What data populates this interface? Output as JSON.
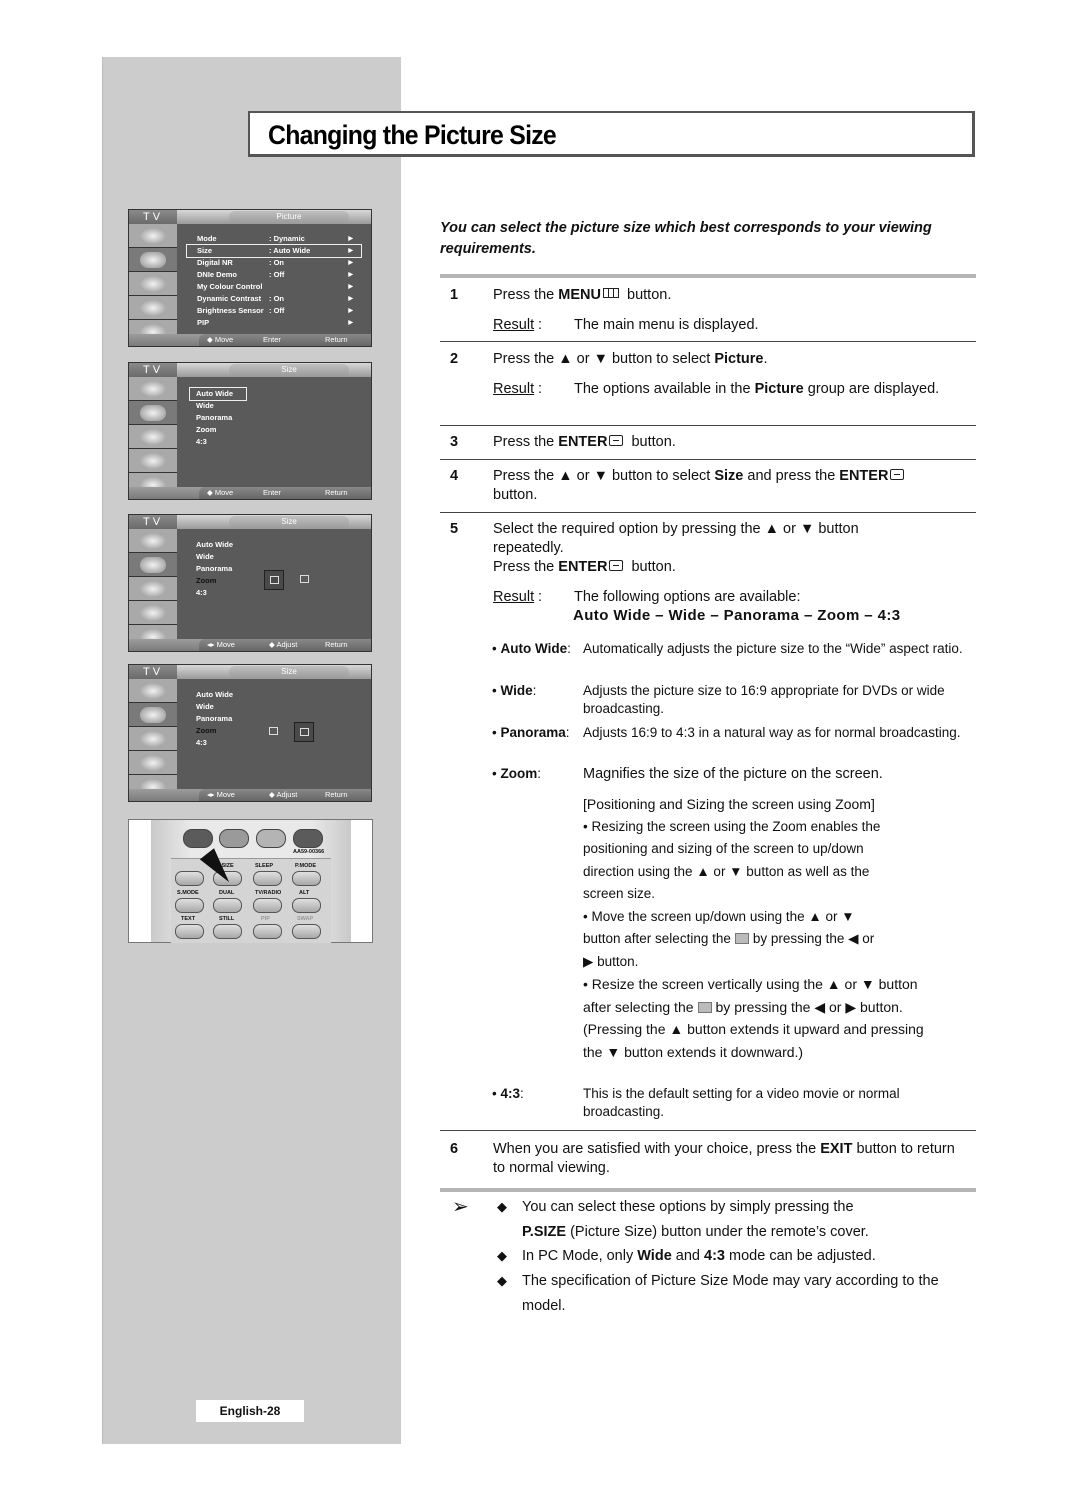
{
  "page": {
    "title": "Changing the Picture Size",
    "intro": "You can select the picture size which best corresponds to your viewing requirements.",
    "page_number": "English-28"
  },
  "osd_screens": [
    {
      "tv_label": "TV",
      "menu_title": "Picture",
      "rows": [
        {
          "label": "Mode",
          "value": ": Dynamic"
        },
        {
          "label": "Size",
          "value": ": Auto Wide",
          "highlighted": true
        },
        {
          "label": "Digital NR",
          "value": ": On"
        },
        {
          "label": "DNIe Demo",
          "value": ": Off"
        },
        {
          "label": "My Colour Control",
          "value": ""
        },
        {
          "label": "Dynamic Contrast",
          "value": ": On"
        },
        {
          "label": "Brightness Sensor",
          "value": ": Off"
        },
        {
          "label": "PIP",
          "value": ""
        }
      ],
      "hints": [
        "◆ Move",
        "Enter",
        "Return"
      ]
    },
    {
      "tv_label": "TV",
      "menu_title": "Size",
      "rows": [
        "Auto Wide",
        "Wide",
        "Panorama",
        "Zoom",
        "4:3"
      ],
      "selected": "Auto Wide",
      "hints": [
        "◆ Move",
        "Enter",
        "Return"
      ]
    },
    {
      "tv_label": "TV",
      "menu_title": "Size",
      "rows": [
        "Auto Wide",
        "Wide",
        "Panorama",
        "Zoom",
        "4:3"
      ],
      "selected": "Zoom",
      "zoom_focus": "position",
      "hints": [
        "◂▸ Move",
        "◆ Adjust",
        "Return"
      ]
    },
    {
      "tv_label": "TV",
      "menu_title": "Size",
      "rows": [
        "Auto Wide",
        "Wide",
        "Panorama",
        "Zoom",
        "4:3"
      ],
      "selected": "Zoom",
      "zoom_focus": "size",
      "hints": [
        "◂▸ Move",
        "◆ Adjust",
        "Return"
      ]
    }
  ],
  "remote": {
    "model_code": "AA59-00366",
    "color_buttons": [
      "#5b5b5b",
      "#9a9a9a",
      "#b4b4b4",
      "#5b5b5b"
    ],
    "row1": [
      "",
      "P.SIZE",
      "SLEEP",
      "P.MODE"
    ],
    "row2": [
      "S.MODE",
      "DUAL",
      "TV/RADIO",
      "ALT"
    ],
    "row3": [
      "TEXT",
      "STILL",
      "PIP",
      "SWAP"
    ]
  },
  "steps": [
    {
      "num": "1",
      "pre": "Press the ",
      "bold": "MENU",
      "post": " button.",
      "result": "The main menu is displayed."
    },
    {
      "num": "2",
      "pre": "Press the ▲ or ▼ button to select ",
      "bold": "Picture",
      "post": ".",
      "result_pre": "The options available in the ",
      "result_bold": "Picture",
      "result_post": " group are displayed."
    },
    {
      "num": "3",
      "pre": "Press the ",
      "bold": "ENTER",
      "post": " button."
    },
    {
      "num": "4",
      "pre": "Press the ▲ or ▼ button to select ",
      "bold": "Size",
      "mid": " and press the ",
      "bold2": "ENTER",
      "post": "button."
    },
    {
      "num": "5",
      "line1": "Select the required option by pressing the ▲ or ▼ button repeatedly.",
      "line2_pre": "Press the ",
      "line2_bold": "ENTER",
      "line2_post": " button.",
      "result": "The following options are available:",
      "options": "Auto Wide – Wide – Panorama – Zoom – 4:3"
    },
    {
      "num": "6",
      "pre": "When you are satisfied with your choice, press the ",
      "bold": "EXIT",
      "post": " button to return to normal viewing."
    }
  ],
  "result_label": "Result",
  "definitions": [
    {
      "term": "Auto Wide",
      "desc": "Automatically adjusts the picture size to the “Wide” aspect ratio."
    },
    {
      "term": "Wide",
      "desc": "Adjusts the picture size to 16:9 appropriate for DVDs or wide broadcasting."
    },
    {
      "term": "Panorama",
      "desc": "Adjusts 16:9 to 4:3 in a natural way as for normal broadcasting."
    },
    {
      "term": "Zoom",
      "desc": "Magnifies the size of the picture on the screen."
    },
    {
      "term": "4:3",
      "desc": "This is the default setting for a video movie or normal broadcasting."
    }
  ],
  "zoom_section": {
    "heading": "[Positioning and Sizing the screen using Zoom]",
    "bullet1": "• Resizing the screen using the Zoom enables the positioning and sizing of the screen to up/down direction using the ▲ or ▼ button as well as the screen size.",
    "bullet2_pre": "• Move the screen up/down using the ▲ or ▼ button after selecting the",
    "bullet2_post": "by pressing the ◀ or ▶ button.",
    "bullet3_pre": "• Resize the screen vertically using the ▲ or ▼ button after selecting the",
    "bullet3_post": "by pressing the ◀ or ▶ button. (Pressing the ▲ button extends it upward and pressing the ▼ button extends it downward.)"
  },
  "notes": [
    {
      "pre": "You can select these options by simply pressing the ",
      "bold": "P.SIZE",
      "post": " (Picture Size) button under the remote’s cover."
    },
    {
      "pre": "In PC Mode, only ",
      "bold": "Wide",
      "mid": " and ",
      "bold2": "4:3",
      "post": " mode can be adjusted."
    },
    {
      "pre": "The specification of Picture Size Mode may vary according to the model."
    }
  ],
  "glyphs": {
    "note_arrow": "➢",
    "diamond": "◆",
    "bullet": "•"
  }
}
